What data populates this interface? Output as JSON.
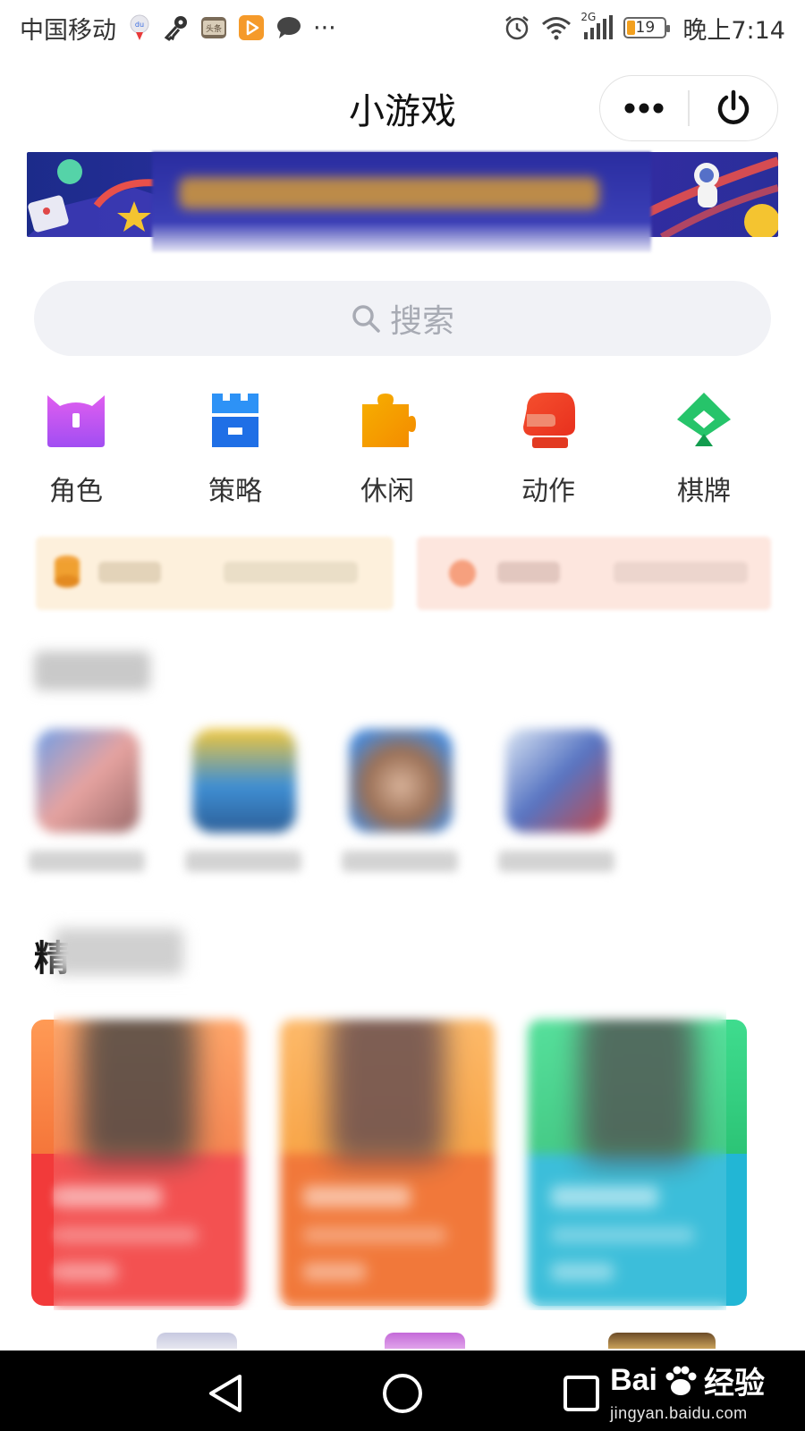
{
  "status_bar": {
    "carrier": "中国移动",
    "more": "···",
    "network_type": "2G",
    "battery_level": "19",
    "battery_fraction": 0.19,
    "time": "晚上7:14",
    "icons": [
      "baidu-map-icon",
      "key-icon",
      "toutiao-icon",
      "video-icon",
      "message-icon",
      "alarm-icon",
      "wifi-icon",
      "signal-icon",
      "battery-icon"
    ],
    "toutiao_label": "头条"
  },
  "nav": {
    "title": "小游戏",
    "menu_icon": "more-dots-icon",
    "close_icon": "power-icon"
  },
  "search": {
    "placeholder": "搜索",
    "icon": "search-icon"
  },
  "categories": [
    {
      "label": "角色",
      "icon": "horned-helmet-icon",
      "color": "#c74cf0"
    },
    {
      "label": "策略",
      "icon": "castle-tower-icon",
      "color": "#2d7cf6"
    },
    {
      "label": "休闲",
      "icon": "puzzle-piece-icon",
      "color": "#f5a300"
    },
    {
      "label": "动作",
      "icon": "boxing-glove-icon",
      "color": "#f24428"
    },
    {
      "label": "棋牌",
      "icon": "spade-card-icon",
      "color": "#1db861"
    }
  ],
  "featured": {
    "title_fragment": "精"
  },
  "colors": {
    "accent_blue": "#2d7cf6",
    "search_bg": "#f1f2f6",
    "card_red": "#f23a3a",
    "card_orange": "#f0661f",
    "card_teal": "#22b6d5"
  },
  "bottom_nav": {
    "back_icon": "back-triangle-icon",
    "home_icon": "home-circle-icon",
    "recents_icon": "recents-square-icon"
  },
  "watermark": {
    "brand_prefix": "Bai",
    "brand_suffix": "经验",
    "url": "jingyan.baidu.com"
  }
}
